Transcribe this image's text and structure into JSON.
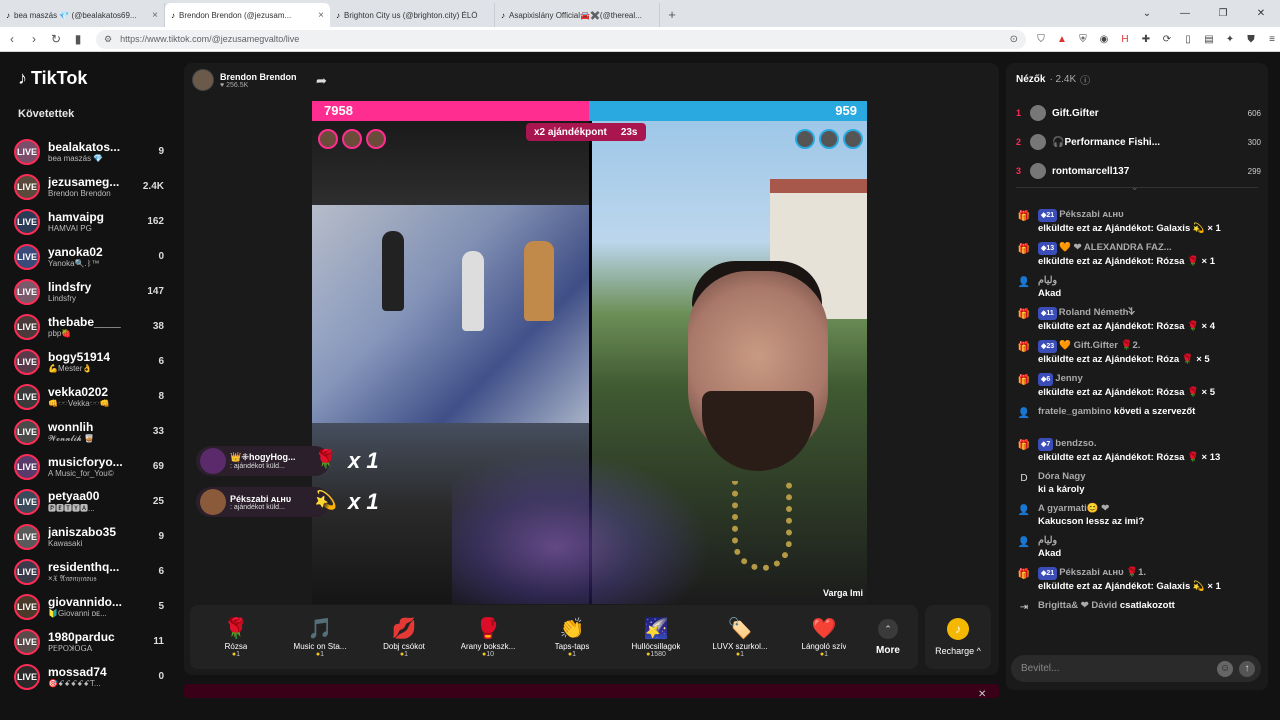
{
  "browser": {
    "tabs": [
      {
        "title": "bea maszás 💎 (@bealakatos69...",
        "active": false
      },
      {
        "title": "Brendon Brendon (@jezusam...",
        "active": true
      },
      {
        "title": "Brighton City us (@brighton.city) ÉLŐ",
        "active": false
      },
      {
        "title": "Asapixislány Official🚘✖️(@thereal...",
        "active": false
      }
    ],
    "new_tab": "+",
    "url": "https://www.tiktok.com/@jezusamegvalto/live"
  },
  "sidebar": {
    "logo_text": "TikTok",
    "section_title": "Követettek",
    "items": [
      {
        "name": "bealakatos...",
        "sub": "bea maszás 💎",
        "count": "9",
        "color": "#7a4d6a"
      },
      {
        "name": "jezusameg...",
        "sub": "Brendon Brendon",
        "count": "2.4K",
        "color": "#5a4a3c"
      },
      {
        "name": "hamvaipg",
        "sub": "HAMVAI PG",
        "count": "162",
        "color": "#2b3a55"
      },
      {
        "name": "yanoka02",
        "sub": "Yanoka🔍.ᛒ™",
        "count": "0",
        "color": "#3a4a7a"
      },
      {
        "name": "lindsfry",
        "sub": "Lindsfry",
        "count": "147",
        "color": "#7a5a6a"
      },
      {
        "name": "thebabe____",
        "sub": "pbp🍓",
        "count": "38",
        "color": "#4a3a3a"
      },
      {
        "name": "bogy51914",
        "sub": "💪Mester👌",
        "count": "6",
        "color": "#5a3a4a"
      },
      {
        "name": "vekka0202",
        "sub": "👊🕶️Vekka🕶️👊",
        "count": "8",
        "color": "#3a3a3a"
      },
      {
        "name": "wonnlih",
        "sub": "𝓦𝓸𝓷𝓷𝓵𝓲𝓱 🥃",
        "count": "33",
        "color": "#4a4a4a"
      },
      {
        "name": "musicforyo...",
        "sub": "A Music_for_You©",
        "count": "69",
        "color": "#5a3a6a"
      },
      {
        "name": "petyaa00",
        "sub": "🅿🅴🆃🆈🅰...",
        "count": "25",
        "color": "#3a4a5a"
      },
      {
        "name": "janiszabo35",
        "sub": "Kawasaki",
        "count": "9",
        "color": "#5a5a5a"
      },
      {
        "name": "residenthq...",
        "sub": "×𝔛 𝔄𝔫𝔬𝔫𝔶𝔪𝔬𝔲𝔰",
        "count": "6",
        "color": "#3a3a4a"
      },
      {
        "name": "giovannido...",
        "sub": "🔰Giovanni ᴅᴇ...",
        "count": "5",
        "color": "#4a3a2a"
      },
      {
        "name": "1980parduc",
        "sub": "ꓑꓰꓑꓳꓘꓳꓖꓮ",
        "count": "11",
        "color": "#5a4a4a"
      },
      {
        "name": "mossad74",
        "sub": "🎯ꗃꗃꗃꗃꗃT...",
        "count": "0",
        "color": "#2a2a2a"
      }
    ]
  },
  "stream": {
    "host_name": "Brendon Brendon",
    "host_likes": "♥ 256.5K",
    "score_left": "7958",
    "score_right": "959",
    "bonus_label": "x2 ajándékpont",
    "timer": "23s",
    "right_caption": "Varga Imi",
    "combos": [
      {
        "name": "👑ꔰhogyHog...",
        "sub": ": ajándékot küld...",
        "gift": "🌹",
        "mult": "x 1"
      },
      {
        "name": "Pékszabi ᴀʟʜᴜ",
        "sub": ": ajándékot küld...",
        "gift": "💫",
        "mult": "x 1"
      }
    ]
  },
  "gifts": [
    {
      "icon": "🌹",
      "label": "Rózsa",
      "price": "1"
    },
    {
      "icon": "🎵",
      "label": "Music on Sta...",
      "price": "1"
    },
    {
      "icon": "💋",
      "label": "Dobj csókot",
      "price": "1"
    },
    {
      "icon": "🥊",
      "label": "Arany bokszk...",
      "price": "10"
    },
    {
      "icon": "👏",
      "label": "Taps-taps",
      "price": "1"
    },
    {
      "icon": "🌠",
      "label": "Hullócsillagok",
      "price": "1580"
    },
    {
      "icon": "🏷️",
      "label": "LUVX szurkol...",
      "price": "1"
    },
    {
      "icon": "❤️",
      "label": "Lángoló szív",
      "price": "1"
    }
  ],
  "more_label": "More",
  "recharge_label": "Recharge ^",
  "viewers": {
    "title": "Nézők",
    "count": "· 2.4K",
    "top": [
      {
        "rank": "1",
        "name": "Gift.Gifter",
        "points": "606"
      },
      {
        "rank": "2",
        "name": "🎧Performance Fishi...",
        "points": "300"
      },
      {
        "rank": "3",
        "name": "rontomarcell137",
        "points": "299"
      }
    ]
  },
  "chat": [
    {
      "icon": "🎁",
      "level": "21",
      "name": "Pékszabi ᴀʟʜᴜ",
      "text": "elküldte ezt az Ajándékot: Galaxis 💫 × 1"
    },
    {
      "icon": "🎁",
      "level": "13",
      "name": "🧡 ❤ ALEXANDRA FAZ...",
      "text": "elküldte ezt az Ajándékot: Rózsa 🌹 × 1"
    },
    {
      "icon": "👤",
      "level": "",
      "name": "وليام",
      "text": "Akad"
    },
    {
      "icon": "🎁",
      "level": "11",
      "name": "Roland Németh𐊙",
      "text": "elküldte ezt az Ajándékot: Rózsa 🌹 × 4"
    },
    {
      "icon": "🎁",
      "level": "23",
      "name": "🧡 Gift.Gifter 🌹2.",
      "text": "elküldte ezt az Ajándékot: Róza 🌹 × 5"
    },
    {
      "icon": "🎁",
      "level": "6",
      "name": "Jenny",
      "text": "elküldte ezt az Ajándékot: Rózsa 🌹 × 5"
    },
    {
      "icon": "👤",
      "level": "",
      "name": "fratele_gambino",
      "text": "követi a szervezőt"
    },
    {
      "icon": "🎁",
      "level": "7",
      "name": "bendzso.",
      "text": "elküldte ezt az Ajándékot: Rózsa 🌹 × 13"
    },
    {
      "icon": "D",
      "level": "",
      "name": "Dóra Nagy",
      "text": "ki a károly"
    },
    {
      "icon": "👤",
      "level": "",
      "name": "A gyarmati😊 ❤",
      "text": "Kakucson lessz az imi?"
    },
    {
      "icon": "👤",
      "level": "",
      "name": "وليام",
      "text": "Akad"
    },
    {
      "icon": "🎁",
      "level": "21",
      "name": "Pékszabi ᴀʟʜᴜ 🌹1.",
      "text": "elküldte ezt az Ajándékot: Galaxis 💫 × 1"
    },
    {
      "icon": "⇥",
      "level": "",
      "name": "Brigitta& ❤ Dávid",
      "text": "csatlakozott"
    }
  ],
  "input": {
    "placeholder": "Bevitel..."
  }
}
